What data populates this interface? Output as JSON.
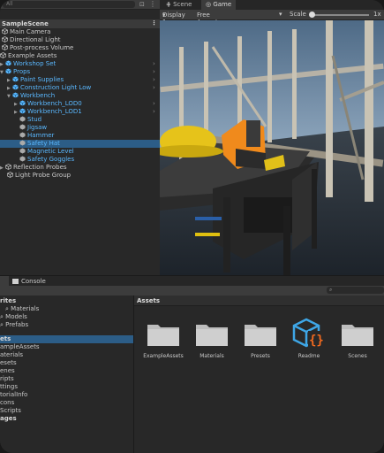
{
  "hierarchy": {
    "search_placeholder": "All",
    "scene": "SampleScene",
    "items": [
      {
        "label": "Main Camera"
      },
      {
        "label": "Directional Light"
      },
      {
        "label": "Post-process Volume"
      },
      {
        "label": "Example Assets"
      },
      {
        "label": "Workshop Set"
      },
      {
        "label": "Props"
      },
      {
        "label": "Paint Supplies"
      },
      {
        "label": "Construction Light Low"
      },
      {
        "label": "Workbench"
      },
      {
        "label": "Workbench_LOD0"
      },
      {
        "label": "Workbench_LOD1"
      },
      {
        "label": "Stud"
      },
      {
        "label": "Jigsaw"
      },
      {
        "label": "Hammer"
      },
      {
        "label": "Safety Hat"
      },
      {
        "label": "Magnetic Level"
      },
      {
        "label": "Safety Goggles"
      },
      {
        "label": "Reflection Probes"
      },
      {
        "label": "Light Probe Group"
      }
    ]
  },
  "viewtabs": {
    "scene": "Scene",
    "game": "Game"
  },
  "gametoolbar": {
    "display": "Display 1",
    "aspect": "Free Aspect",
    "scale_label": "Scale",
    "scale_value": "1x"
  },
  "bottom": {
    "console_tab": "Console",
    "left_items": [
      "rites",
      "Materials",
      "Models",
      "Prefabs",
      "ets",
      "ampleAssets",
      "aterials",
      "esets",
      "enes",
      "ripts",
      "ttings",
      "torialInfo",
      "cons",
      "Scripts",
      "ages"
    ],
    "assets_header": "Assets",
    "tiles": [
      "ExampleAssets",
      "Materials",
      "Presets",
      "Readme",
      "Scenes"
    ]
  },
  "colors": {
    "selection": "#2c5d87",
    "blue_prefab": "#5ab8ff",
    "readme_icon": "#3ea6e6",
    "readme_brace": "#f26a1f"
  }
}
